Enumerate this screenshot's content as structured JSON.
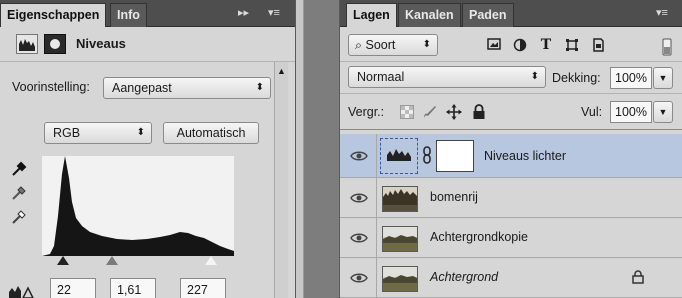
{
  "properties_panel": {
    "tabs": [
      {
        "label": "Eigenschappen",
        "active": true
      },
      {
        "label": "Info",
        "active": false
      }
    ],
    "controls": {
      "collapse": "▸▸",
      "menu": "▾≡"
    },
    "header": {
      "title": "Niveaus"
    },
    "preset": {
      "label": "Voorinstelling:",
      "value": "Aangepast"
    },
    "channel": {
      "value": "RGB",
      "auto_button": "Automatisch"
    },
    "levels": {
      "black": "22",
      "gamma": "1,61",
      "white": "227"
    }
  },
  "layers_panel": {
    "tabs": [
      {
        "label": "Lagen",
        "active": true
      },
      {
        "label": "Kanalen",
        "active": false
      },
      {
        "label": "Paden",
        "active": false
      }
    ],
    "menu": "▾≡",
    "filter": {
      "value": "Soort"
    },
    "blend": {
      "mode": "Normaal",
      "opacity_label": "Dekking:",
      "opacity": "100%"
    },
    "lock": {
      "label": "Vergr.:",
      "fill_label": "Vul:",
      "fill": "100%"
    },
    "layers": [
      {
        "name": "Niveaus lichter",
        "selected": true,
        "italic": false,
        "type": "adjustment"
      },
      {
        "name": "bomenrij",
        "selected": false,
        "italic": false,
        "type": "image"
      },
      {
        "name": "Achtergrondkopie",
        "selected": false,
        "italic": false,
        "type": "image"
      },
      {
        "name": "Achtergrond",
        "selected": false,
        "italic": true,
        "type": "image",
        "locked": true
      }
    ]
  },
  "colors": {
    "panel_bg": "#d6d6d6",
    "tabbar_bg": "#4e4e4e",
    "selected_row": "#b7c7e0"
  }
}
